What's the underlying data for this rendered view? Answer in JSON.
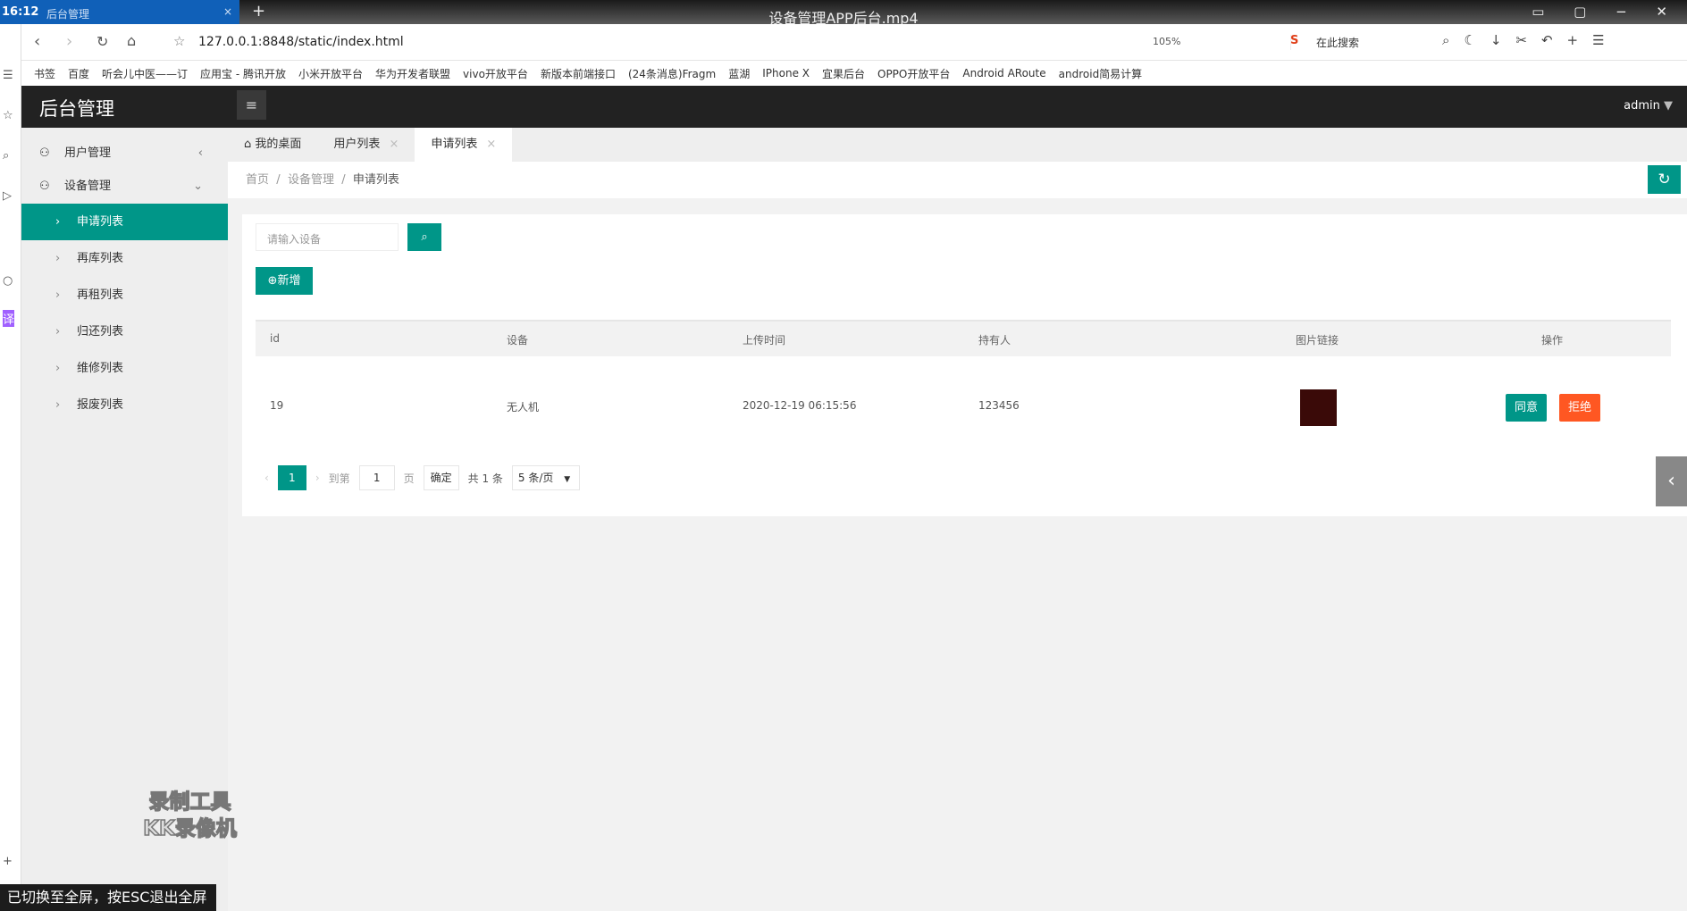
{
  "browser": {
    "clock": "16:12",
    "tab_title": "后台管理",
    "window_title": "设备管理APP后台.mp4",
    "url": "127.0.0.1:8848/static/index.html",
    "zoom": "105%",
    "search_placeholder": "在此搜索",
    "bookmarks": [
      "书签",
      "百度",
      "听会儿中医——订",
      "应用宝 - 腾讯开放",
      "小米开放平台",
      "华为开发者联盟",
      "vivo开放平台",
      "新版本前端接口",
      "(24条消息)Fragm",
      "蓝湖",
      "IPhone X",
      "宜果后台",
      "OPPO开放平台",
      "Android ARoute",
      "android简易计算"
    ]
  },
  "header": {
    "logo": "后台管理",
    "user": "admin"
  },
  "sidebar": {
    "groups": [
      {
        "label": "用户管理"
      },
      {
        "label": "设备管理"
      }
    ],
    "items": [
      {
        "label": "申请列表"
      },
      {
        "label": "再库列表"
      },
      {
        "label": "再租列表"
      },
      {
        "label": "归还列表"
      },
      {
        "label": "维修列表"
      },
      {
        "label": "报废列表"
      }
    ]
  },
  "tabs": [
    {
      "label": "我的桌面"
    },
    {
      "label": "用户列表"
    },
    {
      "label": "申请列表"
    }
  ],
  "breadcrumb": [
    "首页",
    "设备管理",
    "申请列表"
  ],
  "search": {
    "placeholder": "请输入设备"
  },
  "add_label": "新增",
  "table": {
    "columns": [
      "id",
      "设备",
      "上传时间",
      "持有人",
      "图片链接",
      "操作"
    ],
    "rows": [
      {
        "id": "19",
        "device": "无人机",
        "time": "2020-12-19 06:15:56",
        "owner": "123456",
        "agree": "同意",
        "reject": "拒绝"
      }
    ]
  },
  "pager": {
    "current": "1",
    "goto_label": "到第",
    "goto_value": "1",
    "page_label": "页",
    "confirm": "确定",
    "total": "共 1 条",
    "page_size": "5 条/页"
  },
  "watermark": "录制工具 KK录像机",
  "toast": "已切换至全屏，按ESC退出全屏",
  "colors": {
    "accent": "#009688",
    "danger": "#ff5722",
    "header": "#222222"
  }
}
